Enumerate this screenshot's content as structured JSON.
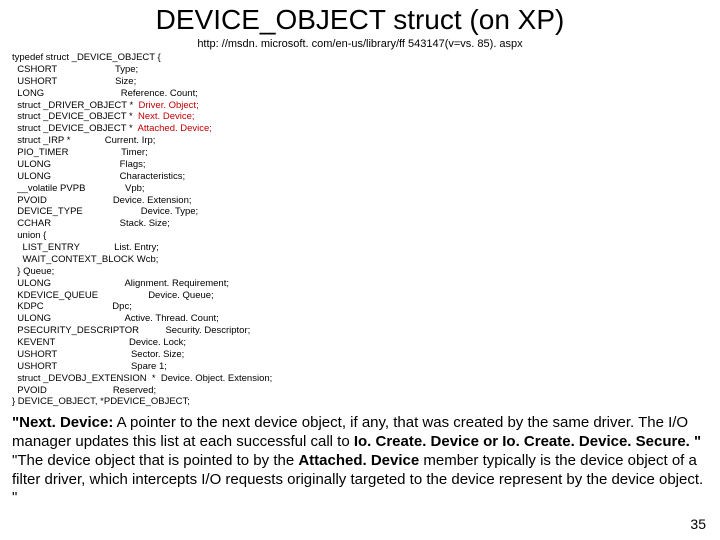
{
  "title": "DEVICE_OBJECT struct (on XP)",
  "url": "http: //msdn. microsoft. com/en-us/library/ff 543147(v=vs. 85). aspx",
  "code": {
    "l01": "typedef struct _DEVICE_OBJECT {",
    "l02": "  CSHORT                      Type;",
    "l03": "  USHORT                      Size;",
    "l04": "  LONG                             Reference. Count;",
    "l05a": "  struct _DRIVER_OBJECT *  ",
    "l05b": "Driver. Object;",
    "l06a": "  struct _DEVICE_OBJECT *  ",
    "l06b": "Next. Device;",
    "l07a": "  struct _DEVICE_OBJECT *  ",
    "l07b": "Attached. Device;",
    "l08": "  struct _IRP *             Current. Irp;",
    "l09": "  PIO_TIMER                    Timer;",
    "l10": "  ULONG                          Flags;",
    "l11": "  ULONG                          Characteristics;",
    "l12": "  __volatile PVPB               Vpb;",
    "l13": "  PVOID                         Device. Extension;",
    "l14": "  DEVICE_TYPE                      Device. Type;",
    "l15": "  CCHAR                          Stack. Size;",
    "l16": "  union {",
    "l17": "    LIST_ENTRY             List. Entry;",
    "l18": "    WAIT_CONTEXT_BLOCK Wcb;",
    "l19": "  } Queue;",
    "l20": "  ULONG                            Alignment. Requirement;",
    "l21": "  KDEVICE_QUEUE                   Device. Queue;",
    "l22": "  KDPC                          Dpc;",
    "l23": "  ULONG                            Active. Thread. Count;",
    "l24": "  PSECURITY_DESCRIPTOR          Security. Descriptor;",
    "l25": "  KEVENT                            Device. Lock;",
    "l26": "  USHORT                            Sector. Size;",
    "l27": "  USHORT                            Spare 1;",
    "l28": "  struct _DEVOBJ_EXTENSION  *  Device. Object. Extension;",
    "l29": "  PVOID                         Reserved;",
    "l30": "} DEVICE_OBJECT, *PDEVICE_OBJECT;"
  },
  "desc": {
    "p1a": "\"Next. Device:",
    "p1b": " A pointer to the next device object, if any, that was created by the same driver. The I/O manager updates this list at each successful call to ",
    "p1c": "Io. Create. Device or Io. Create. Device. Secure. \"",
    "p2a": "\"The device object that is pointed to by the ",
    "p2b": "Attached. Device",
    "p2c": " member typically is the device object of a filter driver, which intercepts I/O requests originally targeted to the device represent by the device object. \""
  },
  "pagenum": "35"
}
